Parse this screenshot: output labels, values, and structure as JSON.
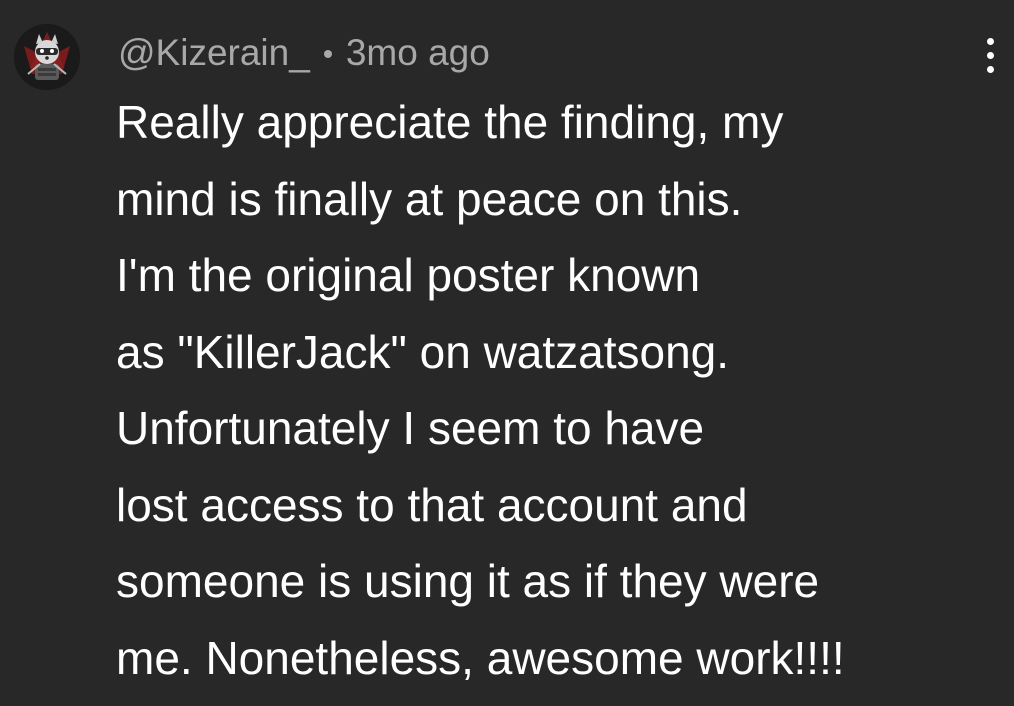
{
  "comment": {
    "username": "@Kizerain_",
    "time_ago": "3mo ago",
    "avatar_icon": "raccoon-avatar-icon",
    "more_icon": "more-vertical-icon",
    "text_lines": [
      "Really appreciate the finding, my",
      "mind is finally at peace on this.",
      "I'm the original poster known",
      "as \"KillerJack\" on watzatsong.",
      "Unfortunately I seem to have",
      "lost access to that account and",
      "someone is using it as if they were",
      "me. Nonetheless, awesome work!!!!"
    ]
  },
  "colors": {
    "background": "#282828",
    "meta_text": "#a8a8a8",
    "body_text": "#ffffff",
    "avatar_accent": "#c0392b"
  }
}
